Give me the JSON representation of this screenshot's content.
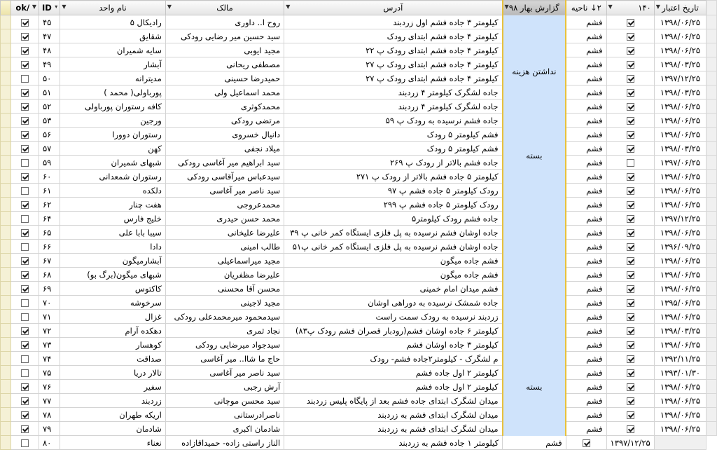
{
  "headers": {
    "ok": "ok/",
    "id": "ID",
    "unit_name": "نام واحد",
    "owner": "مالک",
    "address": "آدرس",
    "report": "گزارش بهار ۹۸",
    "district": "ناحیه",
    "district_sort": "۲↓",
    "c140": "۱۴۰",
    "valid_date": "تاریخ اعتبار"
  },
  "report_groups": [
    {
      "label": "نداشتن هزینه",
      "start": 0,
      "span": 8
    },
    {
      "label": "بسته",
      "start": 8,
      "span": 4
    },
    {
      "label": "",
      "start": 12,
      "span": 11
    },
    {
      "label": "بسته",
      "start": 23,
      "span": 7
    }
  ],
  "rows": [
    {
      "ok": true,
      "id": "۴۵",
      "unit": "رادیکال ۵",
      "owner": "روح ا.. داوری",
      "address": "کیلومتر ۳ جاده فشم اول زردبند",
      "district": "فشم",
      "c140": true,
      "date": "۱۳۹۸/۰۶/۲۵"
    },
    {
      "ok": true,
      "id": "۴۷",
      "unit": "شقایق",
      "owner": "سید حسین میر رضایی رودکی",
      "address": "کیلومتر ۴ جاده فشم ابتدای رودک",
      "district": "فشم",
      "c140": true,
      "date": "۱۳۹۸/۰۶/۲۵"
    },
    {
      "ok": true,
      "id": "۴۸",
      "unit": "سایه شمیران",
      "owner": "مجید ایوبی",
      "address": "کیلومتر ۴ جاده فشم ابتدای رودک پ ۲۲",
      "district": "فشم",
      "c140": true,
      "date": "۱۳۹۸/۰۶/۲۵"
    },
    {
      "ok": true,
      "id": "۴۹",
      "unit": "آبشار",
      "owner": "مصطفی ریحانی",
      "address": "کیلومتر ۴ جاده فشم ابتدای رودک پ ۲۷",
      "district": "فشم",
      "c140": true,
      "date": "۱۳۹۸/۰۳/۲۵"
    },
    {
      "ok": false,
      "id": "۵۰",
      "unit": "مدیترانه",
      "owner": "حمیدرضا حسینی",
      "address": "کیلومتر ۴ جاده فشم ابتدای رودک پ ۲۷",
      "district": "فشم",
      "c140": true,
      "date": "۱۳۹۷/۱۲/۲۵"
    },
    {
      "ok": true,
      "id": "۵۱",
      "unit": "پورباولی( محمد )",
      "owner": "محمد اسماعیل ولی",
      "address": "جاده لشگرک کیلومتر ۴ زردبند",
      "district": "فشم",
      "c140": true,
      "date": "۱۳۹۸/۰۳/۲۵"
    },
    {
      "ok": true,
      "id": "۵۲",
      "unit": "کافه رستوران پورباولی",
      "owner": "محمدکوثری",
      "address": "جاده لشگرک کیلومتر ۴ زردبند",
      "district": "فشم",
      "c140": true,
      "date": "۱۳۹۸/۰۶/۲۵"
    },
    {
      "ok": true,
      "id": "۵۳",
      "unit": "ورجین",
      "owner": "مرتضی رودکی",
      "address": "جاده فشم نرسیده به رودک پ ۵۹",
      "district": "فشم",
      "c140": true,
      "date": "۱۳۹۸/۰۶/۲۵"
    },
    {
      "ok": true,
      "id": "۵۶",
      "unit": "رستوران دوورا",
      "owner": "دانیال خسروی",
      "address": "فشم کیلومتر ۵ رودک",
      "district": "فشم",
      "c140": true,
      "date": "۱۳۹۸/۰۶/۲۵"
    },
    {
      "ok": true,
      "id": "۵۷",
      "unit": "کهن",
      "owner": "میلاد نجفی",
      "address": "فشم کیلومتر ۵ رودک",
      "district": "فشم",
      "c140": true,
      "date": "۱۳۹۸/۰۳/۲۵"
    },
    {
      "ok": false,
      "id": "۵۹",
      "unit": "شبهای شمیران",
      "owner": "سید ابراهیم میر آغاسی رودکی",
      "address": "جاده فشم بالاتر از رودک پ ۲۶۹",
      "district": "فشم",
      "c140": false,
      "date": "۱۳۹۷/۰۶/۲۵"
    },
    {
      "ok": true,
      "id": "۶۰",
      "unit": "رستوران شمعدانی",
      "owner": "سیدعباس میرآقاسی رودکی",
      "address": "کیلومتر ۵ جاده فشم بالاتر از رودک پ ۲۷۱",
      "district": "فشم",
      "c140": true,
      "date": "۱۳۹۸/۰۶/۲۵"
    },
    {
      "ok": false,
      "id": "۶۱",
      "unit": "دلکده",
      "owner": "سید ناصر میر آغاسی",
      "address": "رودک کیلومتر ۵ جاده فشم پ ۹۷",
      "district": "فشم",
      "c140": true,
      "date": "۱۳۹۸/۰۶/۲۵"
    },
    {
      "ok": true,
      "id": "۶۲",
      "unit": "هفت چنار",
      "owner": "محمدعروجی",
      "address": "رودک کیلومتر ۵ جاده فشم پ ۲۹۹",
      "district": "فشم",
      "c140": true,
      "date": "۱۳۹۸/۰۶/۲۵"
    },
    {
      "ok": false,
      "id": "۶۴",
      "unit": "خلیج فارس",
      "owner": "محمد حسن حیدری",
      "address": "جاده فشم رودک کیلومتر۵",
      "district": "فشم",
      "c140": true,
      "date": "۱۳۹۷/۱۲/۲۵"
    },
    {
      "ok": true,
      "id": "۶۵",
      "unit": "سیبا بابا علی",
      "owner": "علیرضا علیخانی",
      "address": "جاده اوشان فشم نرسیده به پل فلزی ایستگاه کمر خانی پ ۳۹",
      "district": "فشم",
      "c140": true,
      "date": "۱۳۹۸/۰۶/۲۵"
    },
    {
      "ok": false,
      "id": "۶۶",
      "unit": "دادا",
      "owner": "طالب امینی",
      "address": "جاده اوشان فشم نرسیده به پل فلزی ایستگاه کمر خانی پ۵۱",
      "district": "فشم",
      "c140": true,
      "date": "۱۳۹۶/۰۹/۲۵"
    },
    {
      "ok": true,
      "id": "۶۷",
      "unit": "آبشارمیگون",
      "owner": "مجید میراسماعیلی",
      "address": "فشم جاده میگون",
      "district": "فشم",
      "c140": true,
      "date": "۱۳۹۸/۰۶/۲۵"
    },
    {
      "ok": true,
      "id": "۶۸",
      "unit": "شبهای میگون(برگ بو)",
      "owner": "علیرضا مظفریان",
      "address": "فشم جاده میگون",
      "district": "فشم",
      "c140": true,
      "date": "۱۳۹۸/۰۶/۲۵"
    },
    {
      "ok": true,
      "id": "۶۹",
      "unit": "کاکتوس",
      "owner": "محسن آقا محسنی",
      "address": "فشم میدان امام خمینی",
      "district": "فشم",
      "c140": true,
      "date": "۱۳۹۸/۰۶/۲۵"
    },
    {
      "ok": false,
      "id": "۷۰",
      "unit": "سرخوشه",
      "owner": "مجید لاجینی",
      "address": "جاده شمشک نرسیده به دوراهی اوشان",
      "district": "فشم",
      "c140": true,
      "date": "۱۳۹۵/۰۶/۲۵"
    },
    {
      "ok": false,
      "id": "۷۱",
      "unit": "غزال",
      "owner": "سیدمحمود میرمحمدعلی رودکی",
      "address": "زردبند نرسیده به رودک سمت راست",
      "district": "فشم",
      "c140": true,
      "date": "۱۳۹۸/۰۶/۲۵"
    },
    {
      "ok": true,
      "id": "۷۲",
      "unit": "دهکده آرام",
      "owner": "نجاد ثمری",
      "address": "کیلومتر ۶ جاده اوشان فشم(رودبار قصران فشم رودک پ۸۳)",
      "district": "فشم",
      "c140": true,
      "date": "۱۳۹۸/۰۳/۲۵"
    },
    {
      "ok": true,
      "id": "۷۳",
      "unit": "کوهسار",
      "owner": "سیدجواد میرضایی رودکی",
      "address": "کیلومتر ۳ جاده اوشان فشم",
      "district": "فشم",
      "c140": true,
      "date": "۱۳۹۸/۰۶/۲۵"
    },
    {
      "ok": false,
      "id": "۷۴",
      "unit": "صداقت",
      "owner": "حاج ما شاا.. میر آغاسی",
      "address": "م لشگرک - کیلومتر۲جاده فشم- رودک",
      "district": "فشم",
      "c140": true,
      "date": "۱۳۹۲/۱۱/۲۵"
    },
    {
      "ok": false,
      "id": "۷۵",
      "unit": "تالار دریا",
      "owner": "سید ناصر میر آغاسی",
      "address": "کیلومتر ۲ اول جاده فشم",
      "district": "فشم",
      "c140": true,
      "date": "۱۳۹۳/۰۱/۳۰"
    },
    {
      "ok": true,
      "id": "۷۶",
      "unit": "سفیر",
      "owner": "آرش رجبی",
      "address": "کیلومتر ۲ اول جاده فشم",
      "district": "فشم",
      "c140": true,
      "date": "۱۳۹۸/۰۶/۲۵"
    },
    {
      "ok": true,
      "id": "۷۷",
      "unit": "زردبند",
      "owner": "سید محسن موچانی",
      "address": "میدان لشگرک ابتدای جاده فشم بعد از پایگاه پلیس زردبند",
      "district": "فشم",
      "c140": true,
      "date": "۱۳۹۸/۰۶/۲۵"
    },
    {
      "ok": true,
      "id": "۷۸",
      "unit": "اریکه طهران",
      "owner": "ناصرادرستانی",
      "address": "میدان لشگرک ابتدای فشم به زردبند",
      "district": "فشم",
      "c140": true,
      "date": "۱۳۹۸/۰۶/۲۵"
    },
    {
      "ok": true,
      "id": "۷۹",
      "unit": "شادمان",
      "owner": "شادمان اکبری",
      "address": "میدان لشگرک ابتدای فشم به زردبند",
      "district": "فشم",
      "c140": true,
      "date": "۱۳۹۸/۰۶/۲۵"
    },
    {
      "ok": false,
      "id": "۸۰",
      "unit": "نعناء",
      "owner": "الناز راستی زاده- حمیداقازاده",
      "address": "کیلومتر ۱ جاده فشم به زردبند",
      "district": "فشم",
      "c140": true,
      "date": "۱۳۹۷/۱۲/۲۵"
    }
  ]
}
